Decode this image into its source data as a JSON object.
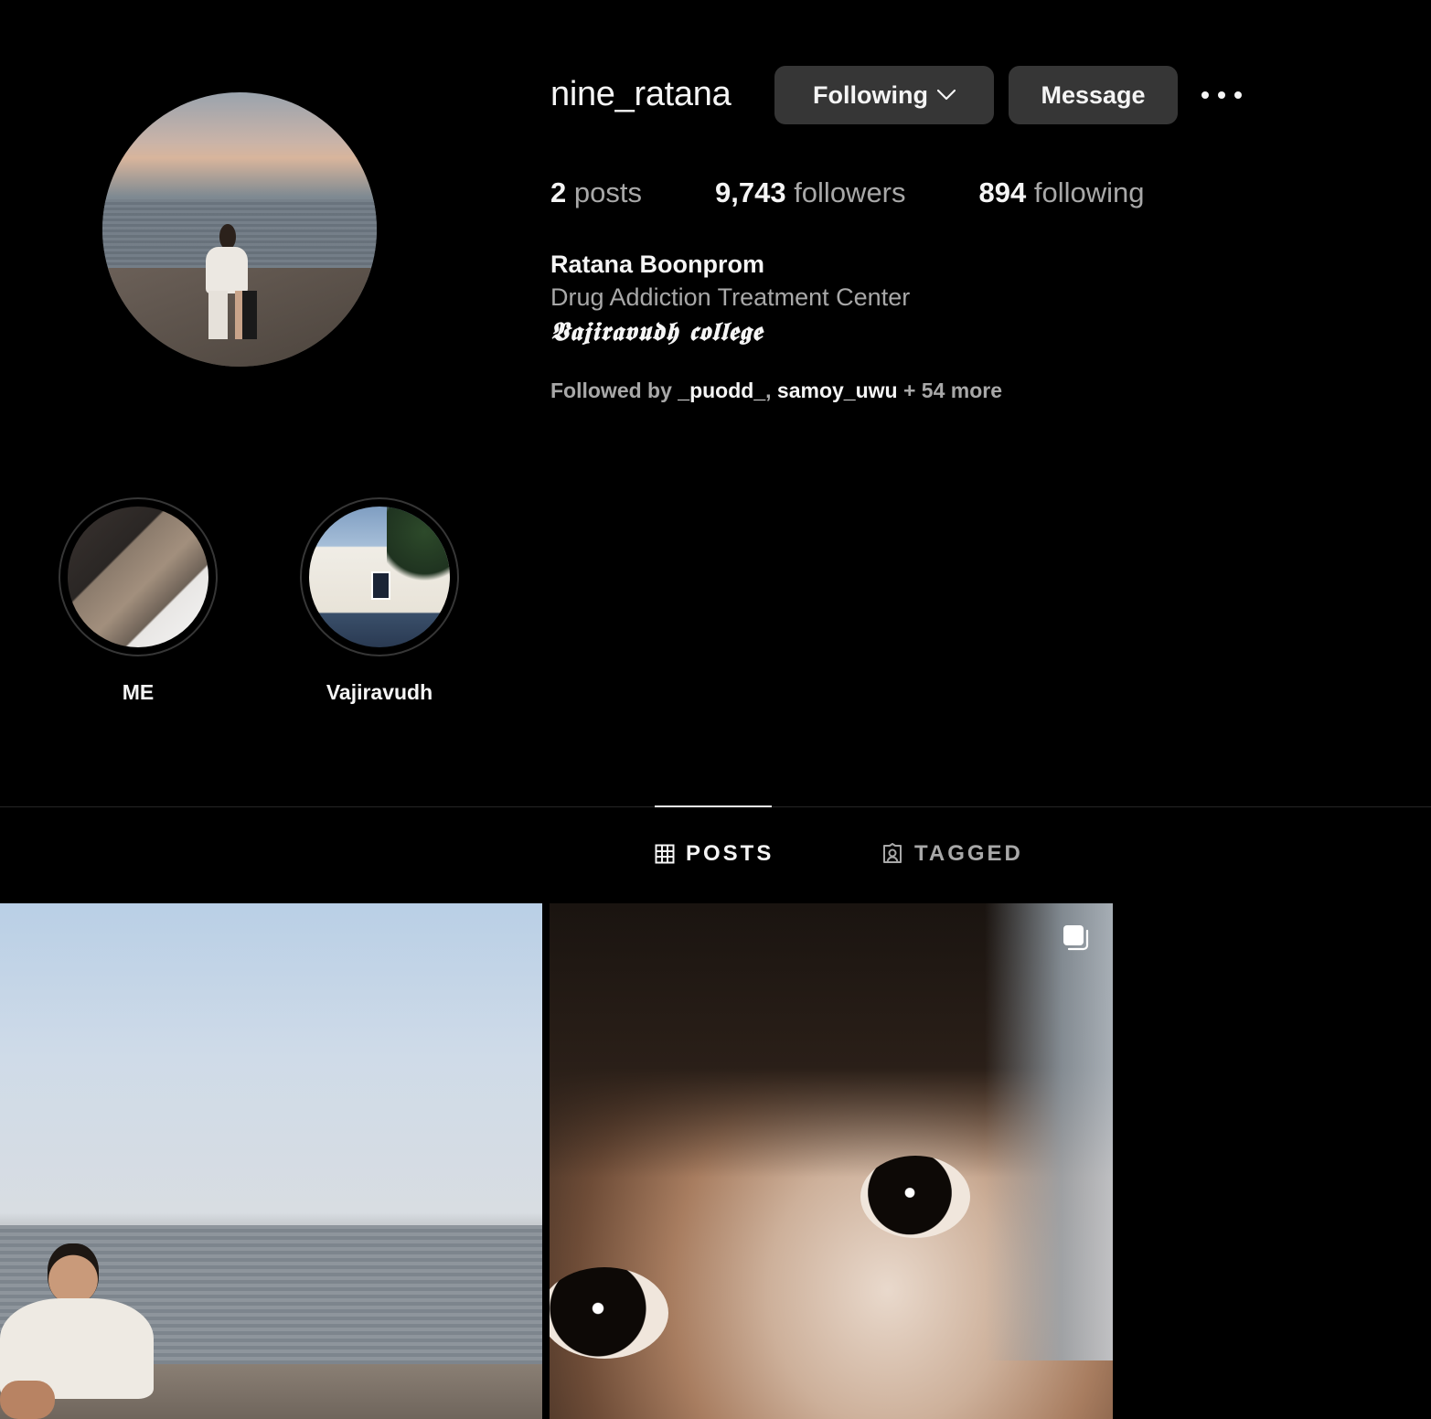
{
  "profile": {
    "username": "nine_ratana",
    "following_button": "Following",
    "message_button": "Message",
    "stats": {
      "posts_count": "2",
      "posts_label": "posts",
      "followers_count": "9,743",
      "followers_label": "followers",
      "following_count": "894",
      "following_label": "following"
    },
    "full_name": "Ratana Boonprom",
    "bio_line1": "Drug Addiction Treatment Center",
    "bio_line2": "𝖁𝖆𝖏𝖎𝖗𝖆𝖛𝖚𝖉𝖍 𝖈𝖔𝖑𝖑𝖊𝖌𝖊",
    "followed_by": {
      "prefix": "Followed by ",
      "user1": "_puodd_",
      "sep": ", ",
      "user2": "samoy_uwu",
      "suffix": " + 54 more"
    }
  },
  "highlights": [
    {
      "label": "ME"
    },
    {
      "label": "Vajiravudh"
    }
  ],
  "tabs": {
    "posts": "POSTS",
    "tagged": "TAGGED"
  },
  "icons": {
    "chevron": "chevron-down-icon",
    "more": "more-icon",
    "grid": "grid-icon",
    "tagged": "tagged-icon",
    "multi": "carousel-icon"
  },
  "colors": {
    "background": "#000000",
    "button": "#363636",
    "text_primary": "#f5f5f5",
    "text_secondary": "#a8a8a8"
  }
}
